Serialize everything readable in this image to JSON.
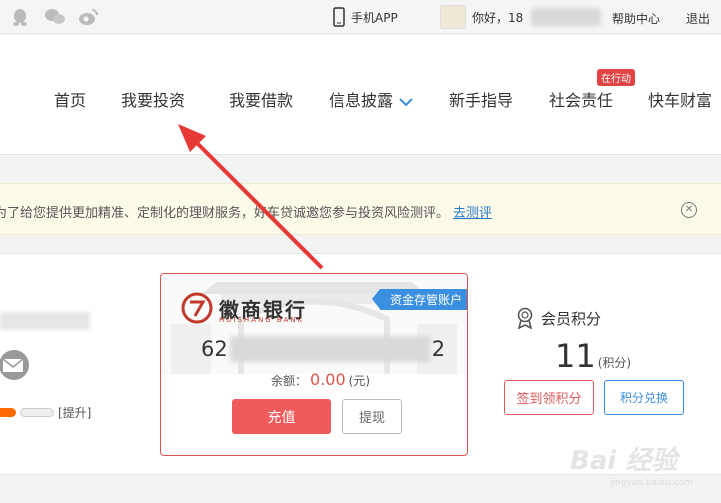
{
  "topbar": {
    "app_label": "手机APP",
    "greeting": "你好，18",
    "help": "帮助中心",
    "logout": "退出"
  },
  "nav": {
    "items": [
      "首页",
      "我要投资",
      "我要借款",
      "信息披露",
      "新手指导",
      "社会责任",
      "快车财富"
    ],
    "badge": "在行动"
  },
  "notice": {
    "text": "为了给您提供更加精准、定制化的理财服务，好车贷诚邀您参与投资风险测评。",
    "link": "去测评"
  },
  "account": {
    "level_link": "[提升]"
  },
  "bank_card": {
    "bank_name": "徽商银行",
    "bank_sub": "HUISHANG BANK",
    "tag": "资金存管账户",
    "card_prefix": "62",
    "card_suffix": "2",
    "balance_label": "余额：",
    "balance_value": "0.00",
    "balance_unit": "(元)",
    "recharge_label": "充值",
    "withdraw_label": "提现"
  },
  "points": {
    "title": "会员积分",
    "value": "11",
    "unit": "(积分)",
    "signin_label": "签到领积分",
    "exchange_label": "积分兑换"
  },
  "watermark": {
    "main": "Bai 经验",
    "sub": "jingyan.baidu.com"
  },
  "colors": {
    "accent_red": "#f15a5a",
    "accent_blue": "#3b8fe0",
    "arrow": "#e53935"
  }
}
